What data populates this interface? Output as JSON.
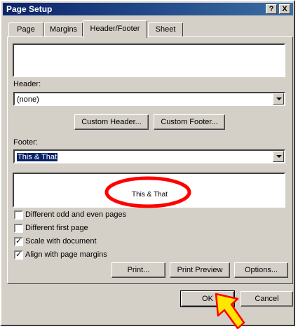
{
  "window": {
    "title": "Page Setup"
  },
  "titlebar_buttons": {
    "help": "?",
    "close": "X"
  },
  "tabs": [
    {
      "label": "Page"
    },
    {
      "label": "Margins"
    },
    {
      "label": "Header/Footer"
    },
    {
      "label": "Sheet"
    }
  ],
  "header": {
    "label": "Header:",
    "value": "(none)"
  },
  "buttons": {
    "custom_header": "Custom Header...",
    "custom_footer": "Custom Footer...",
    "print": "Print...",
    "print_preview": "Print Preview",
    "options": "Options...",
    "ok": "OK",
    "cancel": "Cancel"
  },
  "footer": {
    "label": "Footer:",
    "value": "This & That",
    "preview_text": "This & That"
  },
  "checkboxes": [
    {
      "label": "Different odd and even pages",
      "checked": false
    },
    {
      "label": "Different first page",
      "checked": false
    },
    {
      "label": "Scale with document",
      "checked": true
    },
    {
      "label": "Align with page margins",
      "checked": true
    }
  ],
  "annotation": {
    "ellipse_color": "#ff0000",
    "arrow_fill": "#ffe600",
    "arrow_stroke": "#ff0000"
  }
}
